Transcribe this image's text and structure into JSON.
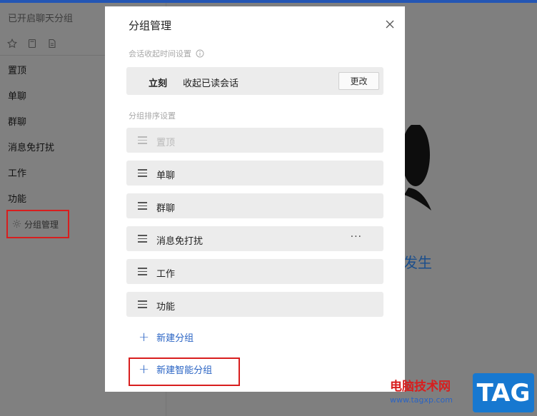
{
  "sidebar": {
    "title": "已开启聊天分组",
    "items": [
      {
        "label": "置顶"
      },
      {
        "label": "单聊"
      },
      {
        "label": "群聊"
      },
      {
        "label": "消息免打扰"
      },
      {
        "label": "工作"
      },
      {
        "label": "功能"
      }
    ],
    "manage_label": "分组管理",
    "icons": [
      "star-icon",
      "note-icon",
      "document-icon"
    ]
  },
  "main": {
    "partial_text": "发生"
  },
  "modal": {
    "title": "分组管理",
    "collapse_section_label": "会话收起时间设置",
    "collapse_when": "立刻",
    "collapse_what": "收起已读会话",
    "change_label": "更改",
    "sort_section_label": "分组排序设置",
    "groups": [
      {
        "label": "置顶",
        "disabled": true
      },
      {
        "label": "单聊"
      },
      {
        "label": "群聊"
      },
      {
        "label": "消息免打扰",
        "more": "···"
      },
      {
        "label": "工作"
      },
      {
        "label": "功能"
      }
    ],
    "add_group": "新建分组",
    "add_smart_group": "新建智能分组"
  },
  "watermark": {
    "site_name": "电脑技术网",
    "url": "www.tagxp.com",
    "tag": "TAG"
  },
  "colors": {
    "accent": "#2a64c4",
    "highlight": "#d81e1e",
    "topbar": "#2456b4"
  }
}
